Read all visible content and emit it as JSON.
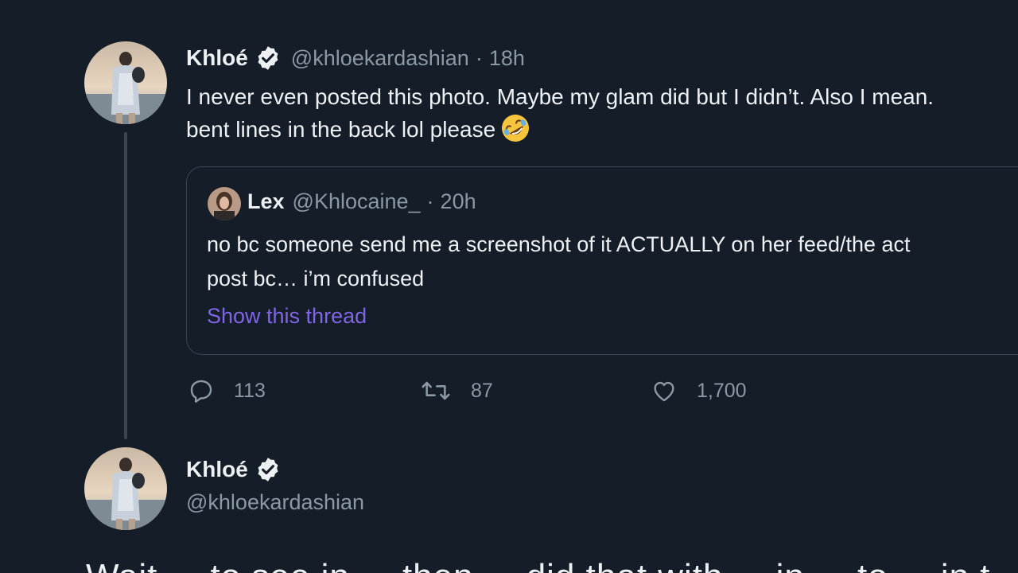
{
  "reply_tweet": {
    "display_name": "Khloé",
    "handle": "@khloekardashian",
    "separator": "·",
    "time": "18h",
    "text_line1": "I never even posted this photo. Maybe my glam did but I didn’t. Also I mean.",
    "text_line2": "bent lines in the back lol please",
    "emoji_icon": "rolling-on-floor-laughing-emoji",
    "quoted": {
      "display_name": "Lex",
      "handle": "@Khlocaine_",
      "separator": "·",
      "time": "20h",
      "text_line1": "no bc someone send me a screenshot of it ACTUALLY on her feed/the act",
      "text_line2": "post bc… i’m confused",
      "show_thread": "Show this thread"
    },
    "actions": {
      "reply_count": "113",
      "retweet_count": "87",
      "like_count": "1,700"
    }
  },
  "main_tweet": {
    "display_name": "Khloé",
    "handle": "@khloekardashian",
    "cropped_text": "Wait ... to see in ... then ... did that with ... in ... to ... in t ..."
  },
  "colors": {
    "background": "#151d28",
    "text_primary": "#eef1f4",
    "text_secondary": "#8b98a5",
    "link": "#7f66e6",
    "border": "#3a4452"
  }
}
